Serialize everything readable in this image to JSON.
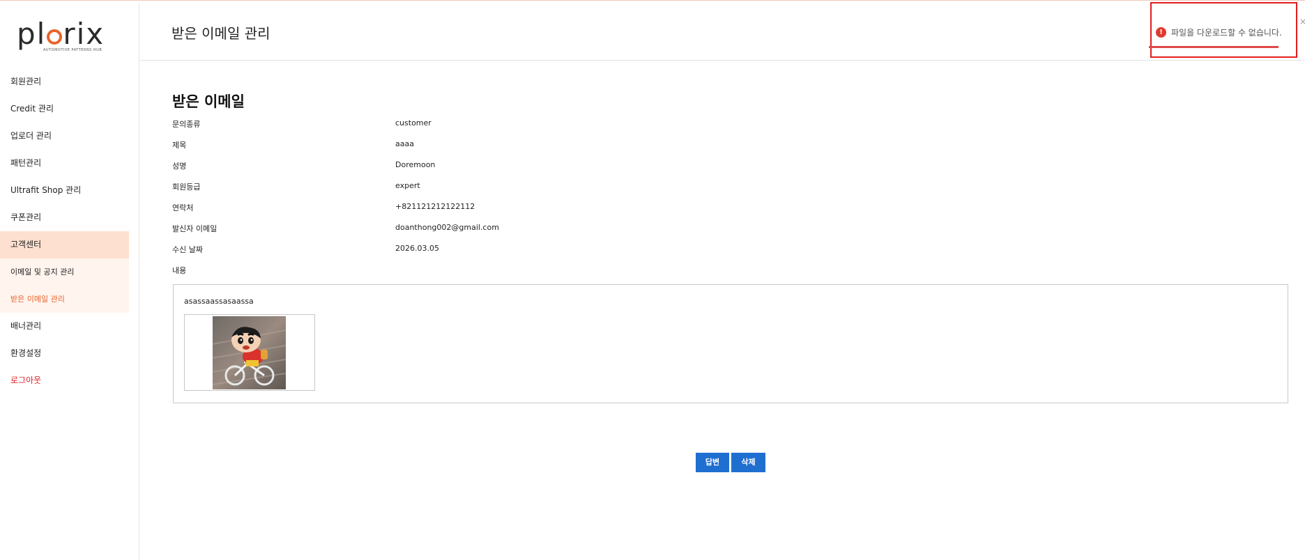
{
  "brand": {
    "logo_text": "plorix",
    "tagline": "AUTOMOTIVE PATTERNS HUB",
    "accent_color": "#e8652b"
  },
  "sidebar": {
    "items": [
      {
        "label": "회원관리"
      },
      {
        "label": "Credit 관리"
      },
      {
        "label": "업로더 관리"
      },
      {
        "label": "패턴관리"
      },
      {
        "label": "Ultrafit Shop 관리"
      },
      {
        "label": "쿠폰관리"
      },
      {
        "label": "고객센터"
      },
      {
        "label": "이메일 및 공지 관리"
      },
      {
        "label": "받은 이메일 관리"
      },
      {
        "label": "배너관리"
      },
      {
        "label": "환경설정"
      },
      {
        "label": "로그아웃"
      }
    ]
  },
  "header": {
    "title": "받은 이메일 관리"
  },
  "toast": {
    "message": "파일을 다운로드할 수 없습니다.",
    "icon": "error-icon",
    "close": "×"
  },
  "main": {
    "section_title": "받은 이메일",
    "fields": [
      {
        "label": "문의종류",
        "value": "customer"
      },
      {
        "label": "제목",
        "value": "aaaa"
      },
      {
        "label": "성명",
        "value": "Doremoon"
      },
      {
        "label": "회원등급",
        "value": "expert"
      },
      {
        "label": "연락처",
        "value": "+821121212122112"
      },
      {
        "label": "발신자 이메일",
        "value": "doanthong002@gmail.com"
      },
      {
        "label": "수신 날짜",
        "value": "2026.03.05"
      },
      {
        "label": "내용",
        "value": ""
      }
    ],
    "content_text": "asassaassasaassa",
    "buttons": {
      "reply": "답변",
      "delete": "삭제"
    }
  }
}
